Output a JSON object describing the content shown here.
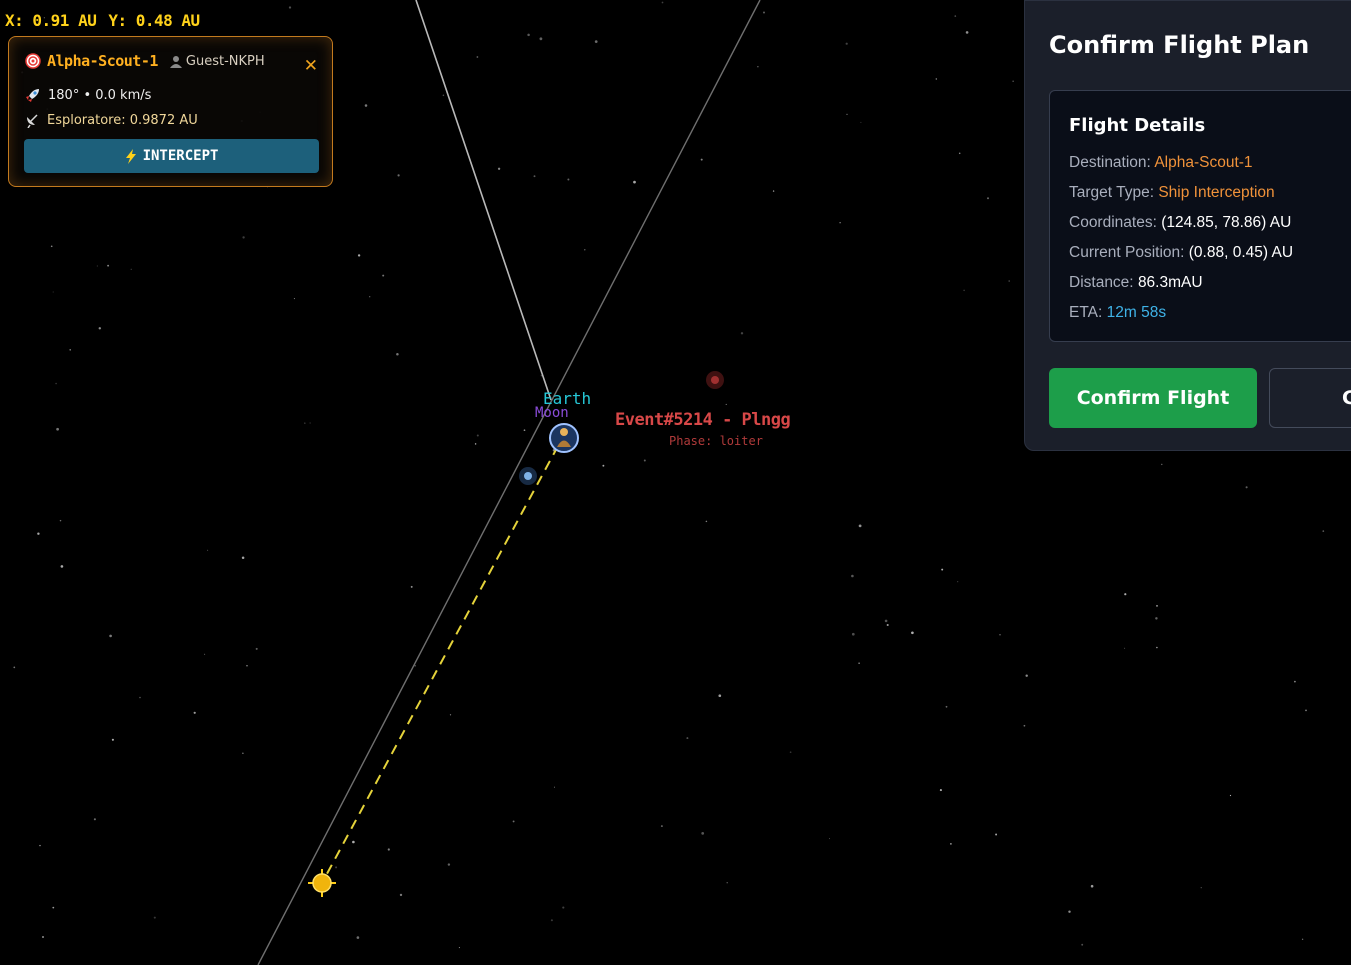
{
  "coords": {
    "x": "X: 0.91 AU",
    "y": "Y: 0.48 AU"
  },
  "target_card": {
    "name": "Alpha-Scout-1",
    "owner": "Guest-NKPH",
    "close": "✕",
    "heading_speed": "180° • 0.0 km/s",
    "explorer_distance": "Esploratore: 0.9872 AU",
    "intercept_label": "INTERCEPT"
  },
  "map": {
    "earth_label": "Earth",
    "moon_label": "Moon",
    "event_label": "Event#5214 - Plngg",
    "event_phase": "Phase: loiter"
  },
  "confirm_panel": {
    "title": "Confirm Flight Plan",
    "details_title": "Flight Details",
    "details": [
      {
        "key": "Destination:",
        "value": "Alpha-Scout-1"
      },
      {
        "key": "Target Type:",
        "value": "Ship Interception"
      },
      {
        "key": "Coordinates:",
        "value": "(124.85, 78.86) AU"
      },
      {
        "key": "Current Position:",
        "value": "(0.88, 0.45) AU"
      },
      {
        "key": "Distance:",
        "value": "86.3mAU"
      },
      {
        "key": "ETA:",
        "value": "12m 58s"
      }
    ],
    "confirm_label": "Confirm Flight",
    "cancel_label": "Cancel"
  },
  "icons": {
    "target": "target-icon",
    "user": "user-icon",
    "rocket": "rocket-icon",
    "satellite": "satellite-icon",
    "bolt": "bolt-icon"
  },
  "colors": {
    "coord_text": "#ffd21a",
    "card_border": "#c37a1e",
    "intercept_button": "#1d607b",
    "earth_label": "#26c7d6",
    "moon_label": "#8a4cd9",
    "event_label": "#d84848",
    "confirm_button": "#1d9e4a",
    "detail_accent": "#f0923a",
    "eta": "#3fb3e8"
  }
}
